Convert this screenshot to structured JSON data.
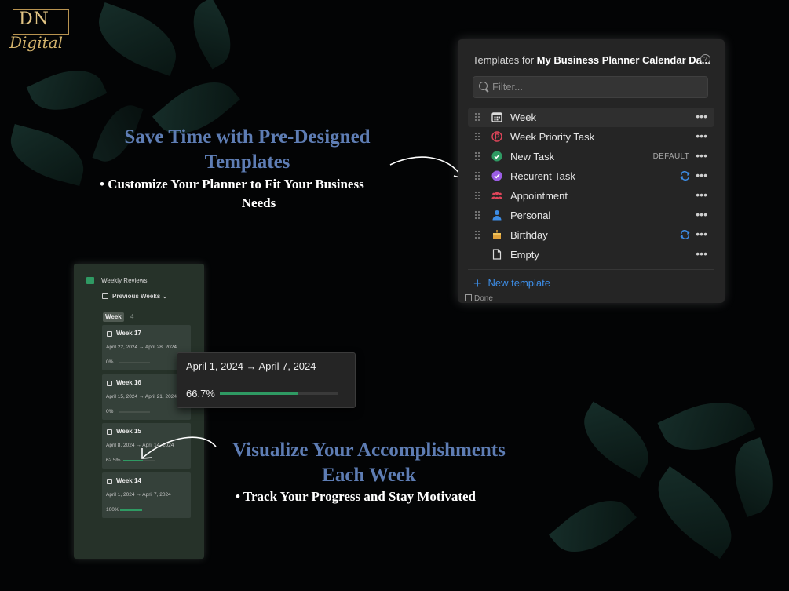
{
  "brand": {
    "monogram": "DN",
    "script": "Digital"
  },
  "promo_top": {
    "headline_line1": "Save Time with Pre-Designed",
    "headline_line2": "Templates",
    "bullet_line1": "•  Customize Your Planner to Fit Your Business",
    "bullet_line2": "Needs"
  },
  "promo_bottom": {
    "headline_line1": "Visualize Your Accomplishments",
    "headline_line2": "Each Week",
    "bullet_line1": "•  Track Your Progress and Stay Motivated"
  },
  "templates_panel": {
    "title_prefix": "Templates for ",
    "title_db": "My Business Planner Calendar Da...",
    "help_icon": "question-circle-icon",
    "filter_placeholder": "Filter...",
    "items": [
      {
        "label": "Week",
        "icon": "calendar-icon",
        "badge": "",
        "repeat": false
      },
      {
        "label": "Week Priority Task",
        "icon": "priority-p-icon",
        "badge": "",
        "repeat": false
      },
      {
        "label": "New Task",
        "icon": "check-circle-icon",
        "badge": "DEFAULT",
        "repeat": false
      },
      {
        "label": "Recurent Task",
        "icon": "purple-check-circle-icon",
        "badge": "",
        "repeat": true
      },
      {
        "label": "Appointment",
        "icon": "group-icon",
        "badge": "",
        "repeat": false
      },
      {
        "label": "Personal",
        "icon": "person-icon",
        "badge": "",
        "repeat": false
      },
      {
        "label": "Birthday",
        "icon": "cake-icon",
        "badge": "",
        "repeat": true
      },
      {
        "label": "Empty",
        "icon": "document-icon",
        "badge": "",
        "repeat": false
      }
    ],
    "more_label": "•••",
    "new_template_label": "New template",
    "background_peek": "Done",
    "colors": {
      "accent": "#3d8de6",
      "green": "#2f9a63",
      "priority": "#e0455a",
      "purple": "#9b5de5",
      "people": "#e0455a",
      "person": "#3d8de6",
      "cake": "#e0a13a"
    }
  },
  "weekly_reviews": {
    "title": "Weekly Reviews",
    "view_label": "Previous Weeks",
    "group_label": "Week",
    "group_count": "4",
    "cards": [
      {
        "title": "Week 17",
        "dates": "April 22, 2024 → April 28, 2024",
        "pct": "0%",
        "progress": 0
      },
      {
        "title": "Week 16",
        "dates": "April 15, 2024 → April 21, 2024",
        "pct": "0%",
        "progress": 0
      },
      {
        "title": "Week 15",
        "dates": "April 8, 2024 → April 14, 2024",
        "pct": "62.5%",
        "progress": 0.625
      },
      {
        "title": "Week 14",
        "dates": "April 1, 2024 → April 7, 2024",
        "pct": "100%",
        "progress": 1.0
      }
    ]
  },
  "tooltip": {
    "dates": "April 1, 2024 → April 7, 2024",
    "pct": "66.7%",
    "progress": 0.667
  }
}
